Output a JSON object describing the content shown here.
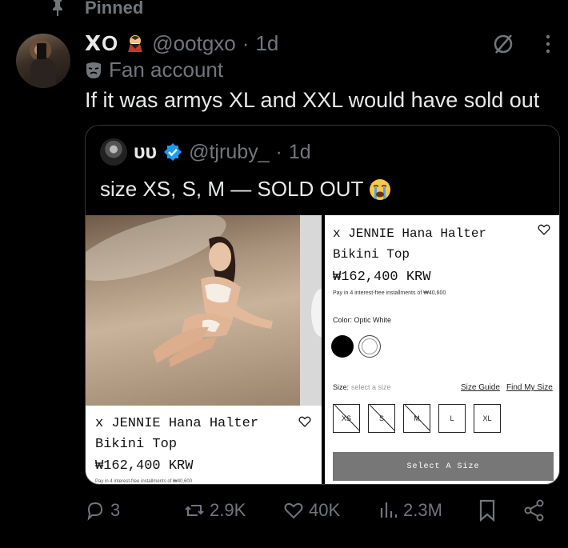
{
  "pinned_label": "Pinned",
  "tweet": {
    "display_name": "ꓫO",
    "handle": "@ootgxo",
    "separator": "·",
    "time": "1d",
    "fan_label": "Fan account",
    "text": "If it was armys XL and XXL would have sold out"
  },
  "quote": {
    "display_name": "ᴜᴜ",
    "handle": "@tjruby_",
    "separator": "·",
    "time": "1d",
    "text": "size XS, S, M — SOLD OUT"
  },
  "media_left": {
    "title_line1": "x JENNIE Hana Halter",
    "title_line2": "Bikini Top",
    "price": "₩162,400 KRW",
    "tiny_text": "Pay in 4 interest-free installments of ₩40,600"
  },
  "media_right": {
    "title_line1": "x JENNIE Hana Halter",
    "title_line2": "Bikini Top",
    "price": "₩162,400 KRW",
    "installments": "Pay in 4 interest-free installments of ₩40,600",
    "color_label": "Color: Optic White",
    "size_label": "Size:",
    "size_placeholder": "select a size",
    "size_guide": "Size Guide",
    "find_my_size": "Find My Size",
    "sizes": [
      {
        "label": "XS",
        "sold_out": true
      },
      {
        "label": "S",
        "sold_out": true
      },
      {
        "label": "M",
        "sold_out": true
      },
      {
        "label": "L",
        "sold_out": false
      },
      {
        "label": "XL",
        "sold_out": false
      }
    ],
    "select_button": "Select A Size"
  },
  "actions": {
    "replies": "3",
    "reposts": "2.9K",
    "likes": "40K",
    "views": "2.3M"
  },
  "colors": {
    "background": "#000000",
    "text": "#e7e9ea",
    "muted": "#71767b",
    "verified": "#1d9bf0"
  }
}
